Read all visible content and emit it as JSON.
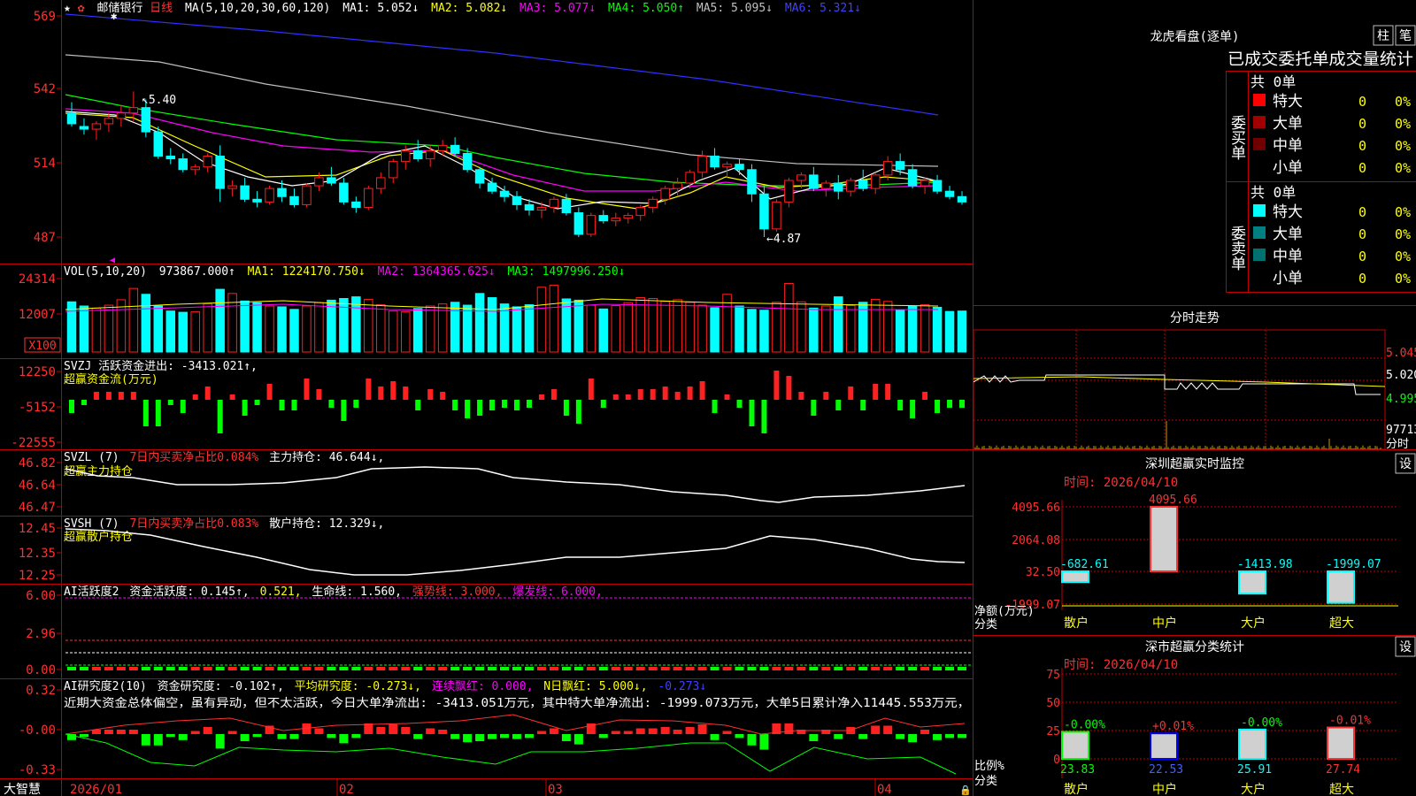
{
  "main_header": {
    "star": "★",
    "stock": "邮储银行",
    "period": "日线",
    "ma_title": "MA(5,10,20,30,60,120)",
    "ma1": "MA1: 5.052↓",
    "ma2": "MA2: 5.082↓",
    "ma3": "MA3: 5.077↓",
    "ma4": "MA4: 5.050↑",
    "ma5": "MA5: 5.095↓",
    "ma6": "MA6: 5.321↓"
  },
  "main_axis": {
    "l569": "569",
    "l542": "542",
    "l514": "514",
    "l487": "487"
  },
  "annotations": {
    "high": "5.40",
    "low": "4.87"
  },
  "vol_header": {
    "title": "VOL(5,10,20)",
    "val": "973867.000↑",
    "ma1": "MA1: 1224170.750↓",
    "ma2": "MA2: 1364365.625↓",
    "ma3": "MA3: 1497996.250↓"
  },
  "vol_axis": {
    "a": "24314",
    "b": "12007",
    "unit": "X100"
  },
  "svzj": {
    "t1": "SVZJ  活跃资金进出: -3413.021↑,",
    "t2": "超赢资金流(万元)",
    "a": "12250",
    "b": "-5152",
    "c": "-22555"
  },
  "svzl": {
    "t1": "SVZL (7)",
    "t2": "7日内买卖净占比0.084%",
    "t3": "主力持仓: 46.644↓,",
    "t4": "超赢主力持仓",
    "a": "46.82",
    "b": "46.64",
    "c": "46.47"
  },
  "svsh": {
    "t1": "SVSH (7)",
    "t2": "7日内买卖净占比0.083%",
    "t3": "散户持仓: 12.329↓,",
    "t4": "超赢散户持仓",
    "a": "12.45",
    "b": "12.35",
    "c": "12.25"
  },
  "ai1": {
    "t1": "AI活跃度2",
    "t2": "资金活跃度: 0.145↑,",
    "t3": "0.521,",
    "t4": "生命线: 1.560,",
    "t5": "强势线: 3.000,",
    "t6": "爆发线: 6.000,",
    "a": "6.00",
    "b": "2.96",
    "c": "0.00"
  },
  "ai2": {
    "t1": "AI研究度2(10)",
    "t2": "资金研究度: -0.102↑,",
    "t3": "平均研究度: -0.273↓,",
    "t4": "连续飘红: 0.000,",
    "t5": "N日飘红: 5.000↓,",
    "t6": "-0.273↓",
    "desc": "近期大资金总体偏空，虽有异动，但不太活跃，今日大单净流出: -3413.051万元，其中特大单净流出: -1999.073万元，大单5日累计净入11445.553万元，",
    "a": "0.32",
    "b": "-0.00",
    "c": "-0.33"
  },
  "dates": {
    "brand": "大智慧",
    "d1": "2026/01",
    "d2": "02",
    "d3": "03",
    "d4": "04"
  },
  "lhb": {
    "title": "龙虎看盘(逐单)",
    "btn1": "柱",
    "btn2": "笔",
    "subtitle": "已成交委托单成交量统计",
    "buy_label": "委买单",
    "sell_label": "委卖单",
    "buy_total": "共 0单",
    "sell_total": "共 0单",
    "rows": [
      {
        "name": "特大",
        "n": "0",
        "p": "0%"
      },
      {
        "name": "大单",
        "n": "0",
        "p": "0%"
      },
      {
        "name": "中单",
        "n": "0",
        "p": "0%"
      },
      {
        "name": "小单",
        "n": "0",
        "p": "0%"
      }
    ]
  },
  "fenshi": {
    "title": "分时走势",
    "p1": "5.045",
    "p2": "5.020",
    "p3": "4.995",
    "vol": "97713",
    "unit": "分时"
  },
  "sz_monitor": {
    "title": "深圳超赢实时监控",
    "btn": "设",
    "date": "时间: 2026/04/10",
    "axis": [
      "4095.66",
      "2064.08",
      "32.50",
      "-1999.07"
    ],
    "ylabel": "净额(万元)",
    "xlabel": "分类",
    "cats": [
      "散户",
      "中户",
      "大户",
      "超大"
    ],
    "vals": [
      "-682.61",
      "4095.66",
      "-1413.98",
      "-1999.07"
    ]
  },
  "sz_class": {
    "title": "深市超赢分类统计",
    "btn": "设",
    "date": "时间: 2026/04/10",
    "axis": [
      "75",
      "50",
      "25",
      "0"
    ],
    "ylabel": "比例%",
    "xlabel": "分类",
    "cats": [
      "散户",
      "中户",
      "大户",
      "超大"
    ],
    "top": [
      "-0.00%",
      "+0.01%",
      "-0.00%",
      "-0.01%"
    ],
    "bottom": [
      "23.83",
      "22.53",
      "25.91",
      "27.74"
    ]
  },
  "colors": {
    "up": "#ff2020",
    "down": "#00ffff",
    "green": "#00ff00",
    "grid": "#c00000"
  },
  "chart_data": [
    {
      "type": "candlestick",
      "title": "邮储银行 日线",
      "y_unit": "price ×100",
      "ylim": [
        480,
        572
      ],
      "x_labels": [
        "2026/01",
        "02",
        "03",
        "04"
      ],
      "ohlc": [
        [
          533,
          537,
          528,
          529
        ],
        [
          528,
          531,
          525,
          527
        ],
        [
          527,
          530,
          523,
          529
        ],
        [
          529,
          533,
          526,
          531
        ],
        [
          531,
          536,
          528,
          533
        ],
        [
          533,
          541,
          530,
          535
        ],
        [
          535,
          538,
          524,
          526
        ],
        [
          526,
          528,
          516,
          517
        ],
        [
          517,
          520,
          514,
          516
        ],
        [
          516,
          518,
          511,
          512
        ],
        [
          512,
          514,
          510,
          513
        ],
        [
          513,
          518,
          511,
          517
        ],
        [
          517,
          521,
          500,
          505
        ],
        [
          505,
          508,
          502,
          506
        ],
        [
          506,
          509,
          500,
          501
        ],
        [
          501,
          504,
          498,
          500
        ],
        [
          500,
          506,
          499,
          505
        ],
        [
          505,
          508,
          500,
          502
        ],
        [
          502,
          505,
          498,
          499
        ],
        [
          499,
          507,
          498,
          506
        ],
        [
          506,
          511,
          504,
          509
        ],
        [
          509,
          513,
          506,
          507
        ],
        [
          507,
          509,
          499,
          500
        ],
        [
          500,
          502,
          496,
          498
        ],
        [
          498,
          506,
          497,
          505
        ],
        [
          505,
          511,
          503,
          509
        ],
        [
          509,
          516,
          507,
          515
        ],
        [
          515,
          521,
          512,
          519
        ],
        [
          519,
          523,
          515,
          516
        ],
        [
          516,
          521,
          513,
          519
        ],
        [
          519,
          523,
          517,
          521
        ],
        [
          521,
          524,
          517,
          518
        ],
        [
          518,
          520,
          511,
          512
        ],
        [
          512,
          513,
          505,
          507
        ],
        [
          507,
          509,
          503,
          504
        ],
        [
          504,
          506,
          500,
          502
        ],
        [
          502,
          504,
          497,
          499
        ],
        [
          499,
          501,
          495,
          497
        ],
        [
          497,
          500,
          494,
          498
        ],
        [
          498,
          502,
          496,
          501
        ],
        [
          501,
          503,
          495,
          496
        ],
        [
          496,
          498,
          487,
          488
        ],
        [
          488,
          496,
          487,
          495
        ],
        [
          495,
          497,
          492,
          493
        ],
        [
          493,
          496,
          491,
          494
        ],
        [
          494,
          496,
          492,
          495
        ],
        [
          495,
          499,
          493,
          498
        ],
        [
          498,
          502,
          496,
          501
        ],
        [
          501,
          506,
          499,
          505
        ],
        [
          505,
          509,
          502,
          507
        ],
        [
          507,
          512,
          505,
          511
        ],
        [
          511,
          519,
          509,
          517
        ],
        [
          517,
          520,
          512,
          513
        ],
        [
          513,
          515,
          509,
          514
        ],
        [
          514,
          516,
          510,
          512
        ],
        [
          512,
          514,
          500,
          503
        ],
        [
          503,
          506,
          487,
          490
        ],
        [
          490,
          501,
          489,
          500
        ],
        [
          500,
          509,
          498,
          508
        ],
        [
          508,
          511,
          505,
          510
        ],
        [
          510,
          513,
          504,
          505
        ],
        [
          505,
          508,
          502,
          507
        ],
        [
          507,
          510,
          501,
          504
        ],
        [
          504,
          509,
          502,
          508
        ],
        [
          508,
          512,
          504,
          505
        ],
        [
          505,
          511,
          503,
          510
        ],
        [
          510,
          517,
          508,
          515
        ],
        [
          515,
          518,
          510,
          512
        ],
        [
          512,
          514,
          505,
          506
        ],
        [
          506,
          509,
          503,
          508
        ],
        [
          508,
          510,
          503,
          504
        ],
        [
          504,
          506,
          501,
          502
        ],
        [
          502,
          504,
          499,
          500
        ]
      ],
      "volume": [
        12000,
        11000,
        10500,
        11200,
        12500,
        15200,
        13800,
        11000,
        9800,
        9500,
        9600,
        11500,
        15000,
        14000,
        12200,
        11800,
        11000,
        10800,
        10200,
        11000,
        11800,
        12400,
        12800,
        13200,
        12600,
        11300,
        9800,
        9600,
        10400,
        11000,
        11500,
        11900,
        11200,
        14000,
        13000,
        11500,
        10800,
        11300,
        15500,
        16000,
        12700,
        12400,
        11200,
        10300,
        11100,
        11800,
        13000,
        12800,
        12100,
        12500,
        11900,
        11200,
        10600,
        13800,
        11000,
        10200,
        10000,
        11900,
        16400,
        12000,
        10500,
        11000,
        13200,
        11100,
        11900,
        12600,
        12100,
        10100,
        10900,
        11300,
        10700,
        9700,
        9800
      ]
    }
  ]
}
